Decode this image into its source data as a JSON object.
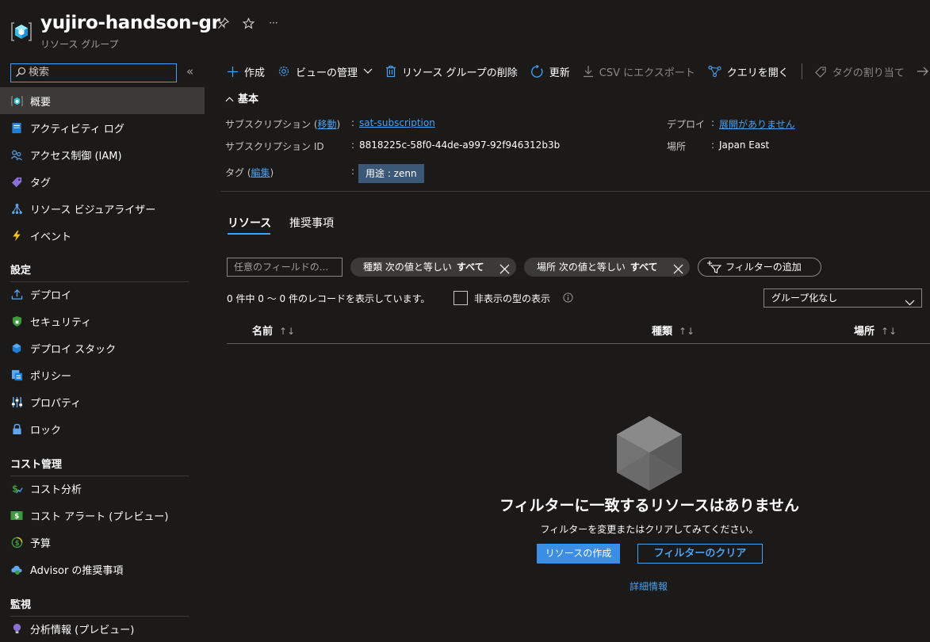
{
  "header": {
    "title": "yujiro-handson-gr",
    "subtitle": "リソース グループ",
    "pin_icon": "pin-icon",
    "star_icon": "star-icon",
    "more_label": "···"
  },
  "sidebar": {
    "search_placeholder": "検索",
    "collapse_label": "«",
    "items": [
      {
        "label": "概要",
        "icon": "overview-cube-icon"
      },
      {
        "label": "アクティビティ ログ",
        "icon": "activity-log-icon"
      },
      {
        "label": "アクセス制御 (IAM)",
        "icon": "iam-people-icon"
      },
      {
        "label": "タグ",
        "icon": "tag-icon"
      },
      {
        "label": "リソース ビジュアライザー",
        "icon": "visualizer-icon"
      },
      {
        "label": "イベント",
        "icon": "lightning-icon"
      }
    ],
    "section_settings": "設定",
    "settings_items": [
      {
        "label": "デプロイ",
        "icon": "deploy-icon"
      },
      {
        "label": "セキュリティ",
        "icon": "shield-icon"
      },
      {
        "label": "デプロイ スタック",
        "icon": "deploy-stack-icon"
      },
      {
        "label": "ポリシー",
        "icon": "policy-icon"
      },
      {
        "label": "プロパティ",
        "icon": "properties-icon"
      },
      {
        "label": "ロック",
        "icon": "lock-icon"
      }
    ],
    "section_cost": "コスト管理",
    "cost_items": [
      {
        "label": "コスト分析",
        "icon": "cost-analysis-icon"
      },
      {
        "label": "コスト アラート (プレビュー)",
        "icon": "cost-alert-icon"
      },
      {
        "label": "予算",
        "icon": "budget-icon"
      },
      {
        "label": "Advisor の推奨事項",
        "icon": "advisor-icon"
      }
    ],
    "section_monitor": "監視",
    "monitor_items": [
      {
        "label": "分析情報 (プレビュー)",
        "icon": "insights-bulb-icon"
      }
    ]
  },
  "toolbar": {
    "create": "作成",
    "manage_view": "ビューの管理",
    "delete_rg": "リソース グループの削除",
    "refresh": "更新",
    "export_csv": "CSV にエクスポート",
    "open_query": "クエリを開く",
    "assign_tags": "タグの割り当て"
  },
  "essentials": {
    "header": "基本",
    "subscription_label": "サブスクリプション (",
    "subscription_move": "移動",
    "subscription_label_end": ")",
    "colon": ":",
    "subscription_value": "sat-subscription",
    "subscription_id_label": "サブスクリプション ID",
    "subscription_id_value": "8818225c-58f0-44de-a997-92f946312b3b",
    "tags_label": "タグ (",
    "tags_edit": "編集",
    "tags_label_end": ")",
    "tag_value": "用途 : zenn",
    "deploy_label": "デプロイ",
    "deploy_value": "展開がありません",
    "location_label": "場所",
    "location_value": "Japan East"
  },
  "tabs": {
    "resources": "リソース",
    "recommendations": "推奨事項"
  },
  "filters": {
    "field_placeholder": "任意のフィールドの...",
    "type_pill_prefix": "種類 次の値と等しい",
    "type_pill_value": "すべて",
    "location_pill_prefix": "場所 次の値と等しい",
    "location_pill_value": "すべて",
    "add_filter": "フィルターの追加"
  },
  "list": {
    "records_text": "0 件中 0 ～ 0 件のレコードを表示しています。",
    "show_hidden_types": "非表示の型の表示",
    "grouping": "グループ化なし",
    "col_name": "名前",
    "col_type": "種類",
    "col_location": "場所",
    "sort_glyph": "↑↓"
  },
  "empty_state": {
    "title": "フィルターに一致するリソースはありません",
    "subtitle": "フィルターを変更またはクリアしてみてください。",
    "create_button": "リソースの作成",
    "clear_button": "フィルターのクリア",
    "more_info": "詳細情報"
  },
  "colors": {
    "background": "#1b1a19",
    "accent": "#4aa0f0",
    "primary_button": "#3b8ee3",
    "active_nav": "#3b3a39",
    "tag_chip": "#3b5877"
  }
}
